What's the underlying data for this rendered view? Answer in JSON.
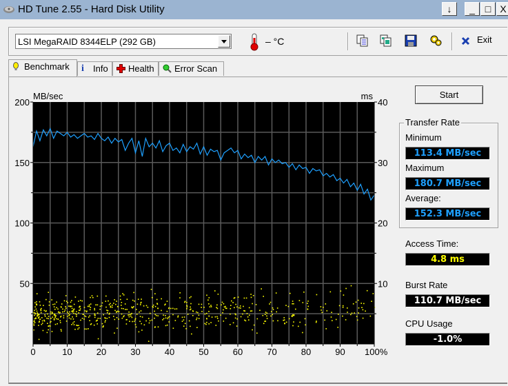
{
  "window": {
    "title": "HD Tune 2.55 - Hard Disk Utility",
    "controls": {
      "pin": "↓",
      "minimize": "_",
      "maximize": "□",
      "close": "X"
    }
  },
  "toolbar": {
    "drive_selected": "LSI    MegaRAID 8344ELP (292 GB)",
    "temperature": "– °C",
    "icons": [
      "copy-text-icon",
      "copy-screenshot-icon",
      "save-icon",
      "options-icon"
    ],
    "exit_label": "Exit"
  },
  "tabs": [
    {
      "label": "Benchmark",
      "icon": "benchmark-icon",
      "active": true
    },
    {
      "label": "Info",
      "icon": "info-icon",
      "active": false
    },
    {
      "label": "Health",
      "icon": "health-icon",
      "active": false
    },
    {
      "label": "Error Scan",
      "icon": "error-scan-icon",
      "active": false
    }
  ],
  "benchmark": {
    "start_label": "Start",
    "transfer_rate_label": "Transfer Rate",
    "minimum_label": "Minimum",
    "minimum_value": "113.4 MB/sec",
    "maximum_label": "Maximum",
    "maximum_value": "180.7 MB/sec",
    "average_label": "Average:",
    "average_value": "152.3 MB/sec",
    "access_time_label": "Access Time:",
    "access_time_value": "4.8 ms",
    "burst_rate_label": "Burst Rate",
    "burst_rate_value": "110.7 MB/sec",
    "cpu_usage_label": "CPU Usage",
    "cpu_usage_value": "-1.0%"
  },
  "chart_data": {
    "type": "line",
    "ylabel_left": "MB/sec",
    "ylabel_right": "ms",
    "xlim": [
      0,
      100
    ],
    "ylim_left": [
      0,
      200
    ],
    "ylim_right": [
      0,
      40
    ],
    "x_ticks": [
      "0",
      "10",
      "20",
      "30",
      "40",
      "50",
      "60",
      "70",
      "80",
      "90",
      "100%"
    ],
    "y_ticks_left": [
      "200",
      "150",
      "100",
      "50"
    ],
    "y_ticks_right": [
      "40",
      "30",
      "20",
      "10"
    ],
    "grid": true,
    "colors": {
      "transfer": "#1ea0ff",
      "access": "#ffff00",
      "background": "#000000",
      "grid": "#5a5a5a"
    },
    "series": [
      {
        "name": "Transfer Rate (MB/sec)",
        "axis": "left",
        "x": [
          0,
          1,
          2,
          3,
          4,
          5,
          6,
          7,
          8,
          9,
          10,
          11,
          12,
          13,
          14,
          15,
          16,
          17,
          18,
          19,
          20,
          21,
          22,
          23,
          24,
          25,
          26,
          27,
          28,
          29,
          30,
          31,
          32,
          33,
          34,
          35,
          36,
          37,
          38,
          39,
          40,
          41,
          42,
          43,
          44,
          45,
          46,
          47,
          48,
          49,
          50,
          51,
          52,
          53,
          54,
          55,
          56,
          57,
          58,
          59,
          60,
          61,
          62,
          63,
          64,
          65,
          66,
          67,
          68,
          69,
          70,
          71,
          72,
          73,
          74,
          75,
          76,
          77,
          78,
          79,
          80,
          81,
          82,
          83,
          84,
          85,
          86,
          87,
          88,
          89,
          90,
          91,
          92,
          93,
          94,
          95,
          96,
          97,
          98,
          99,
          100
        ],
        "values": [
          163,
          176,
          168,
          177,
          172,
          178,
          170,
          176,
          174,
          172,
          175,
          171,
          173,
          170,
          172,
          174,
          171,
          172,
          169,
          174,
          170,
          168,
          171,
          166,
          170,
          167,
          169,
          160,
          166,
          170,
          158,
          168,
          155,
          170,
          163,
          166,
          162,
          168,
          159,
          164,
          166,
          160,
          162,
          158,
          165,
          159,
          163,
          161,
          166,
          157,
          163,
          156,
          161,
          159,
          160,
          152,
          158,
          160,
          162,
          158,
          160,
          153,
          157,
          154,
          156,
          150,
          155,
          152,
          155,
          148,
          153,
          150,
          152,
          149,
          150,
          146,
          149,
          144,
          148,
          145,
          146,
          141,
          145,
          143,
          144,
          139,
          141,
          138,
          140,
          135,
          137,
          133,
          136,
          130,
          133,
          127,
          132,
          124,
          128,
          119,
          123
        ]
      },
      {
        "name": "Access Time (ms)",
        "axis": "right",
        "type": "scatter",
        "center_ms": 5,
        "spread_ms": [
          0.5,
          10
        ]
      }
    ]
  }
}
